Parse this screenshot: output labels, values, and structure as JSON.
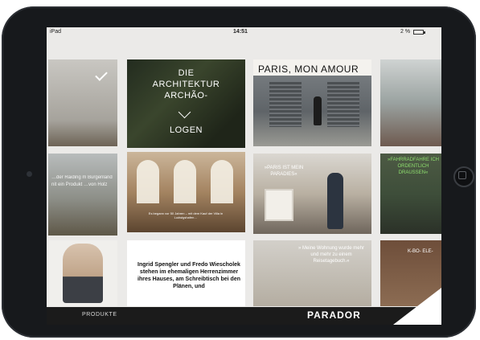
{
  "status_bar": {
    "carrier": "iPad",
    "time": "14:51",
    "battery": "2 %"
  },
  "tiles": {
    "architecture": {
      "line1": "DIE",
      "line2": "ARCHITEKTUR",
      "line3": "ARCHÃO-",
      "line4": "LOGEN"
    },
    "paris": {
      "title": "PARIS, MON AMOUR"
    },
    "left_partial_2": {
      "text": "…der Raiding m Burgenland nit ein Produkt …von Holz"
    },
    "hall": {
      "caption": "Es begann vor 50 Jahren – mit dem Kauf der Villa in Ludwigshafen…"
    },
    "paris_quote": {
      "text": "»PARIS IST MEIN PARADIES«"
    },
    "green_quote": {
      "text": "»FAHRRADFAHRE ICH ORDENTLICH DRAUSSEN«"
    },
    "article": {
      "text": "Ingrid Spengler und Fredo Wiescholek stehen im ehemaligen Herrenzimmer ihres Hauses, am Schreibtisch bei den Plänen, und"
    },
    "wohnung": {
      "text": "» Meine Wohnung wurde mehr und mehr zu einem Reisetagebuch.«"
    },
    "right_partial_3": {
      "text": "K-BO- ELE-"
    }
  },
  "bottom_bar": {
    "nav_link": "PRODUKTE",
    "logo": "PARADOR"
  }
}
